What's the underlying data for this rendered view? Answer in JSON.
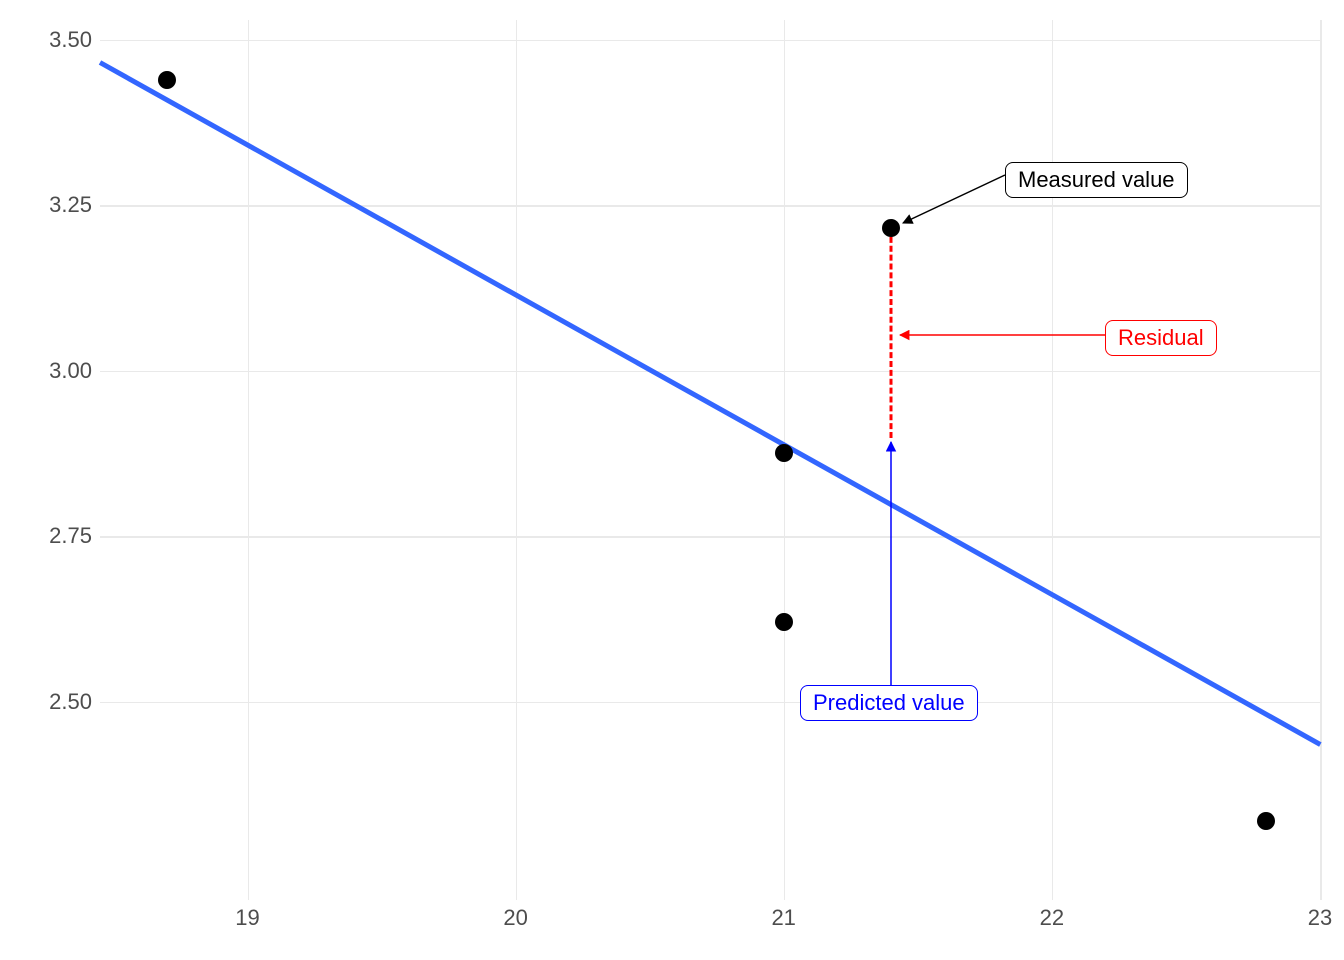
{
  "chart_data": {
    "type": "scatter",
    "x": [
      18.7,
      21.0,
      21.0,
      21.4,
      22.8
    ],
    "y": [
      3.44,
      2.875,
      2.62,
      3.215,
      2.32
    ],
    "regression_line": {
      "x1": 18.45,
      "y1": 3.47,
      "x2": 23.0,
      "y2": 2.44
    },
    "residual_demo": {
      "x": 21.4,
      "y_measured": 3.215,
      "y_predicted": 2.8
    },
    "xlim": [
      18.45,
      23.0
    ],
    "ylim": [
      2.2,
      3.53
    ],
    "x_ticks": [
      19,
      20,
      21,
      22,
      23
    ],
    "y_ticks": [
      2.5,
      2.75,
      3.0,
      3.25,
      3.5
    ],
    "title": "",
    "xlabel": "",
    "ylabel": "",
    "annotations": {
      "measured": "Measured value",
      "residual": "Residual",
      "predicted": "Predicted value"
    }
  },
  "x_tick_labels": [
    "19",
    "20",
    "21",
    "22",
    "23"
  ],
  "y_tick_labels": [
    "2.50",
    "2.75",
    "3.00",
    "3.25",
    "3.50"
  ],
  "labels": {
    "measured": "Measured value",
    "residual": "Residual",
    "predicted": "Predicted value"
  }
}
